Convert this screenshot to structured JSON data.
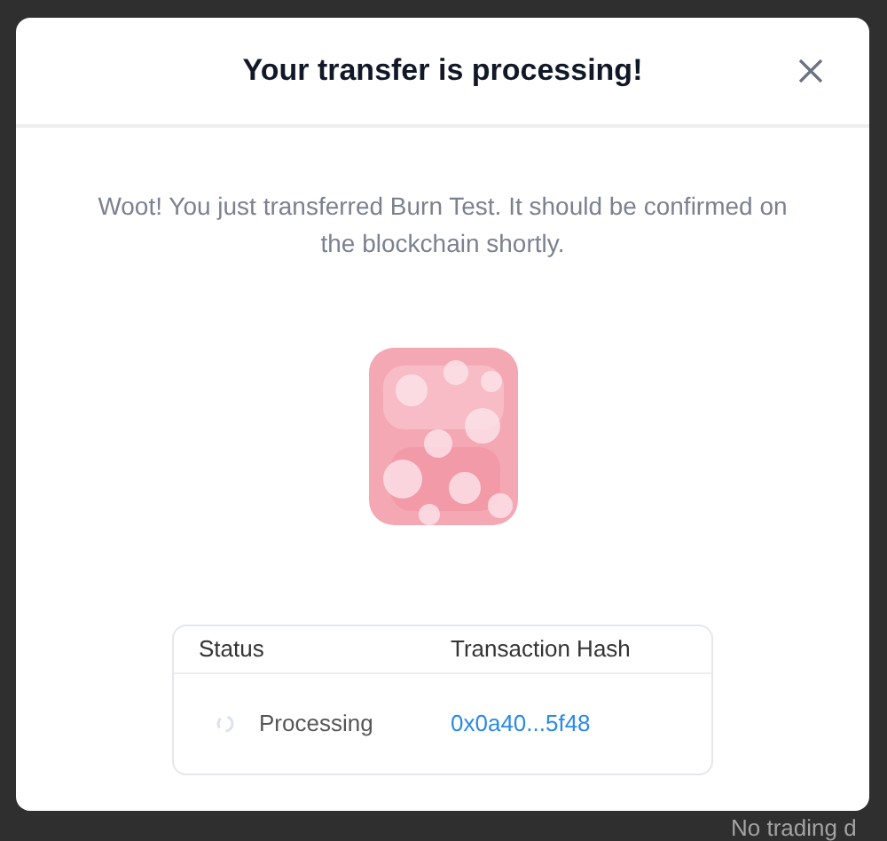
{
  "background": {
    "empty_state": "No trading d"
  },
  "modal": {
    "title": "Your transfer is processing!",
    "message": "Woot! You just transferred Burn Test. It should be confirmed on the blockchain shortly.",
    "table": {
      "columns": [
        "Status",
        "Transaction Hash"
      ],
      "rows": [
        {
          "status": "Processing",
          "hash": "0x0a40...5f48"
        }
      ]
    }
  }
}
